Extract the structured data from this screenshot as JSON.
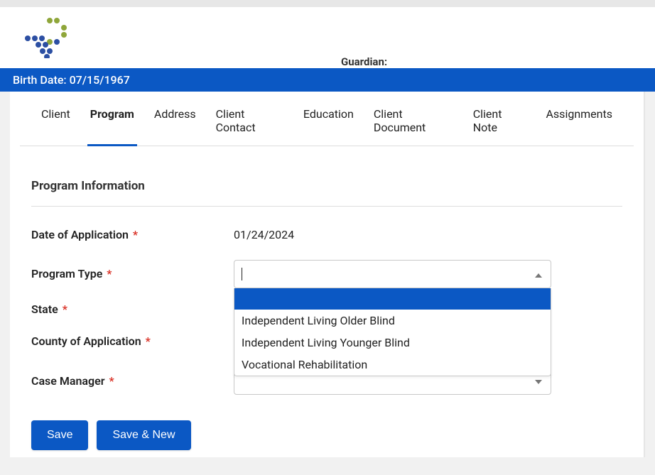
{
  "header": {
    "guardian_label": "Guardian:"
  },
  "birth_bar": "Birth Date: 07/15/1967",
  "tabs": [
    {
      "label": "Client",
      "active": false
    },
    {
      "label": "Program",
      "active": true
    },
    {
      "label": "Address",
      "active": false
    },
    {
      "label": "Client Contact",
      "active": false
    },
    {
      "label": "Education",
      "active": false
    },
    {
      "label": "Client Document",
      "active": false
    },
    {
      "label": "Client Note",
      "active": false
    },
    {
      "label": "Assignments",
      "active": false
    }
  ],
  "section_title": "Program Information",
  "form": {
    "date_of_application": {
      "label": "Date of Application",
      "value": "01/24/2024"
    },
    "program_type": {
      "label": "Program Type",
      "value": "",
      "options": [
        "",
        "Independent Living Older Blind",
        "Independent Living Younger Blind",
        "Vocational Rehabilitation"
      ]
    },
    "state": {
      "label": "State"
    },
    "county": {
      "label": "County of Application"
    },
    "case_manager": {
      "label": "Case Manager",
      "value": ""
    }
  },
  "buttons": {
    "save": "Save",
    "save_new": "Save & New"
  }
}
